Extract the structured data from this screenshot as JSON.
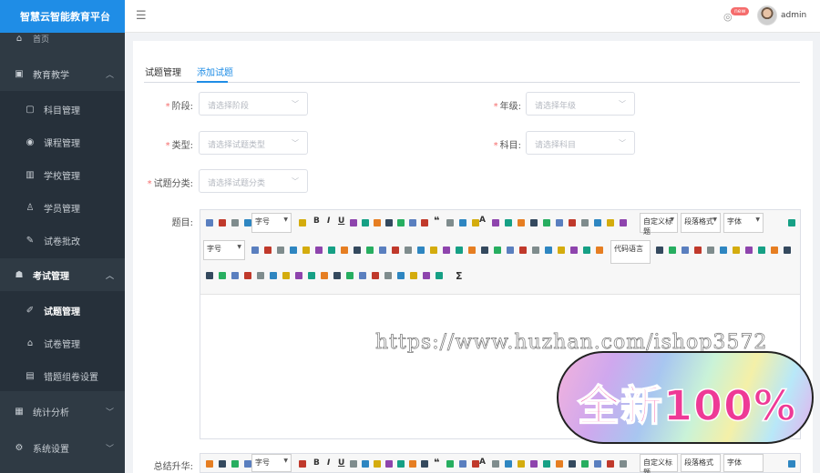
{
  "brand": "智慧云智能教育平台",
  "sidebar": {
    "items": [
      {
        "label": "首页",
        "icon": "home-icon"
      },
      {
        "label": "教育教学",
        "icon": "edu-icon"
      },
      {
        "label": "科目管理",
        "icon": "briefcase-icon"
      },
      {
        "label": "课程管理",
        "icon": "eye-icon"
      },
      {
        "label": "学校管理",
        "icon": "building-icon"
      },
      {
        "label": "学员管理",
        "icon": "user-icon"
      },
      {
        "label": "试卷批改",
        "icon": "pen-icon"
      },
      {
        "label": "考试管理",
        "icon": "exam-icon"
      },
      {
        "label": "试题管理",
        "icon": "edit-icon"
      },
      {
        "label": "试卷管理",
        "icon": "paper-icon"
      },
      {
        "label": "错题组卷设置",
        "icon": "doc-icon"
      },
      {
        "label": "统计分析",
        "icon": "chart-icon"
      },
      {
        "label": "系统设置",
        "icon": "gear-icon"
      }
    ]
  },
  "header": {
    "menu_icon": "☰",
    "badge": "new",
    "username": "admin"
  },
  "tabs": [
    "试题管理",
    "添加试题"
  ],
  "form": {
    "stage_label": "阶段:",
    "stage_placeholder": "请选择阶段",
    "grade_label": "年级:",
    "grade_placeholder": "请选择年级",
    "type_label": "类型:",
    "type_placeholder": "请选择试题类型",
    "subject_label": "科目:",
    "subject_placeholder": "请选择科目",
    "category_label": "试题分类:",
    "category_placeholder": "请选择试题分类",
    "question_label": "题目:",
    "summary_label": "总结升华:"
  },
  "toolbar": {
    "font_size": "字号",
    "title_style": "自定义标题",
    "paragraph": "段落格式",
    "font": "字体",
    "code_lang": "代码语言",
    "bold": "B",
    "italic": "I",
    "underline": "U",
    "quote": "❝",
    "text_color": "A",
    "sigma": "Σ"
  },
  "watermark": "https://www.huzhan.com/ishop3572",
  "stamp": "全新100%",
  "colors": {
    "accent": "#1f8de6",
    "sidebar": "#2f3a44",
    "required": "#f56c6c"
  }
}
